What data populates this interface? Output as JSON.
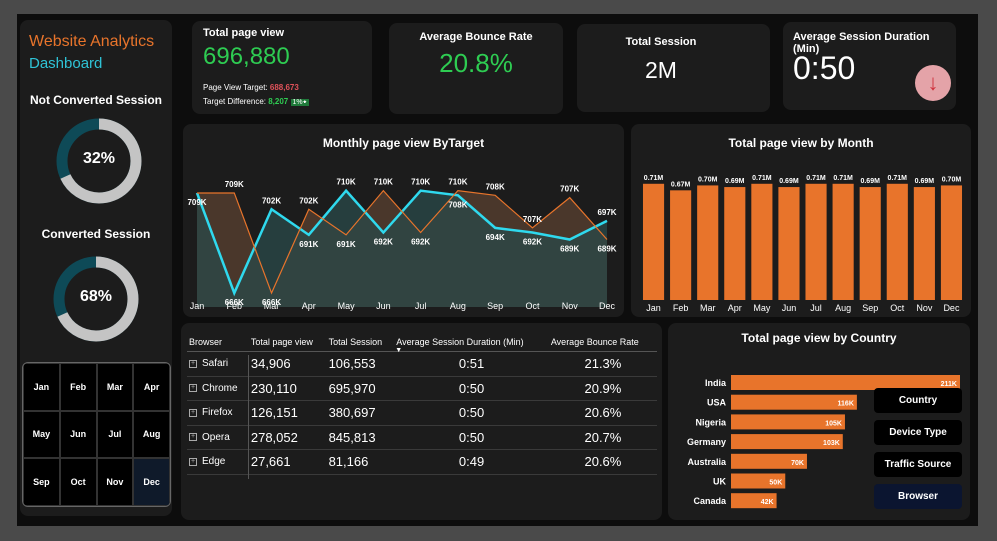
{
  "sidebar": {
    "title": "Website Analytics",
    "subtitle": "Dashboard",
    "not_converted_title": "Not Converted Session",
    "not_converted_value": "32%",
    "not_converted_pct": 32,
    "converted_title": "Converted Session",
    "converted_value": "68%",
    "converted_pct": 68,
    "months": [
      "Jan",
      "Feb",
      "Mar",
      "Apr",
      "May",
      "Jun",
      "Jul",
      "Aug",
      "Sep",
      "Oct",
      "Nov",
      "Dec"
    ],
    "selected_month": "Dec"
  },
  "kpis": {
    "total_page_view": {
      "title": "Total page view",
      "value": "696,880",
      "target_label": "Page View Target:",
      "target_value": "688,673",
      "diff_label": "Target Difference:",
      "diff_value": "8,207",
      "diff_pct": "1%"
    },
    "bounce": {
      "title": "Average Bounce Rate",
      "value": "20.8%"
    },
    "session": {
      "title": "Total Session",
      "value": "2M"
    },
    "duration": {
      "title": "Average Session Duration (Min)",
      "value": "0:50",
      "icon": "arrow-down-icon"
    }
  },
  "colors": {
    "orange": "#e8742b",
    "cyan": "#2fd9ee",
    "green": "#2ecc52",
    "red": "#e0525a"
  },
  "chart_data": [
    {
      "type": "line",
      "title": "Monthly page view ByTarget",
      "categories": [
        "Jan",
        "Feb",
        "Mar",
        "Apr",
        "May",
        "Jun",
        "Jul",
        "Aug",
        "Sep",
        "Oct",
        "Nov",
        "Dec"
      ],
      "series": [
        {
          "values": [
            709,
            666,
            702,
            691,
            710,
            692,
            710,
            708,
            694,
            692,
            689,
            697
          ],
          "labels": [
            "709K",
            "666K",
            "702K",
            "691K",
            "710K",
            "692K",
            "710K",
            "708K",
            "694K",
            "692K",
            "689K",
            "697K"
          ]
        },
        {
          "values": [
            709,
            709,
            666,
            702,
            691,
            710,
            692,
            710,
            708,
            694,
            707,
            689
          ],
          "labels": [
            "",
            "709K",
            "666K",
            "702K",
            "691K",
            "710K",
            "692K",
            "710K",
            "708K",
            "707K",
            "707K",
            "689K"
          ]
        }
      ],
      "ylim": [
        660,
        715
      ]
    },
    {
      "type": "bar",
      "title": "Total page view by Month",
      "categories": [
        "Jan",
        "Feb",
        "Mar",
        "Apr",
        "May",
        "Jun",
        "Jul",
        "Aug",
        "Sep",
        "Oct",
        "Nov",
        "Dec"
      ],
      "values": [
        0.71,
        0.67,
        0.7,
        0.69,
        0.71,
        0.69,
        0.71,
        0.71,
        0.69,
        0.71,
        0.69,
        0.7
      ],
      "labels": [
        "0.71M",
        "0.67M",
        "0.70M",
        "0.69M",
        "0.71M",
        "0.69M",
        "0.71M",
        "0.71M",
        "0.69M",
        "0.71M",
        "0.69M",
        "0.70M"
      ],
      "ylim": [
        0,
        0.75
      ]
    },
    {
      "type": "bar",
      "orientation": "horizontal",
      "title": "Total page view by Country",
      "categories": [
        "India",
        "USA",
        "Nigeria",
        "Germany",
        "Australia",
        "UK",
        "Canada"
      ],
      "values": [
        211,
        116,
        105,
        103,
        70,
        50,
        42
      ],
      "labels": [
        "211K",
        "116K",
        "105K",
        "103K",
        "70K",
        "50K",
        "42K"
      ]
    }
  ],
  "table": {
    "headers": [
      "Browser",
      "Total page view",
      "Total Session",
      "Average Session Duration (Min)",
      "Average Bounce Rate"
    ],
    "rows": [
      [
        "Safari",
        "34,906",
        "106,553",
        "0:51",
        "21.3%"
      ],
      [
        "Chrome",
        "230,110",
        "695,970",
        "0:50",
        "20.9%"
      ],
      [
        "Firefox",
        "126,151",
        "380,697",
        "0:50",
        "20.6%"
      ],
      [
        "Opera",
        "278,052",
        "845,813",
        "0:50",
        "20.7%"
      ],
      [
        "Edge",
        "27,661",
        "81,166",
        "0:49",
        "20.6%"
      ]
    ]
  },
  "country_buttons": [
    "Country",
    "Device Type",
    "Traffic Source",
    "Browser"
  ],
  "active_country_button": "Browser"
}
